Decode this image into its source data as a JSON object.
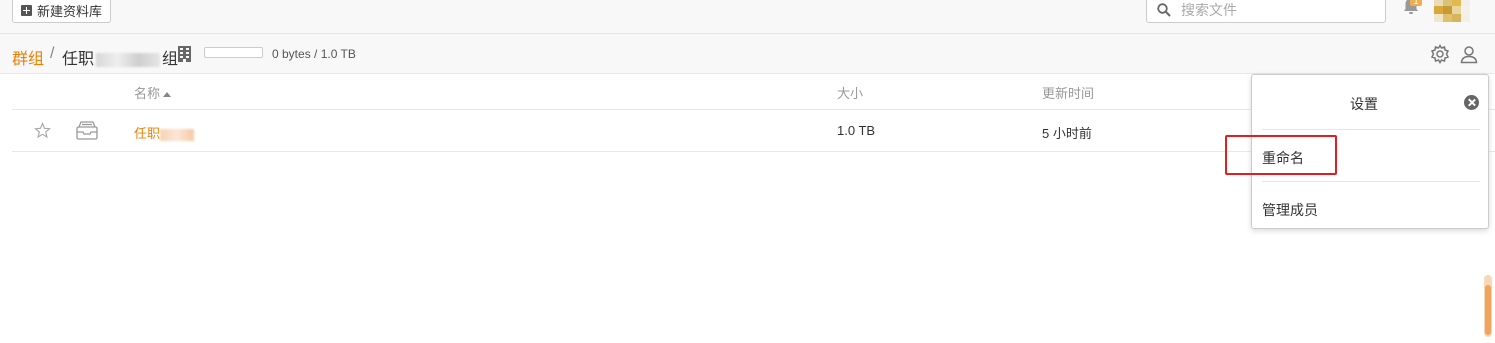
{
  "topbar": {
    "new_library_label": "新建资料库",
    "search_placeholder": "搜索文件",
    "notification_count": "1"
  },
  "pathbar": {
    "crumb_root": "群组",
    "crumb_sep": "/",
    "crumb_current_prefix": "任职",
    "crumb_current_suffix": "组",
    "quota_used_fraction": 0,
    "quota_text": "0 bytes / 1.0 TB"
  },
  "table": {
    "headers": {
      "name": "名称",
      "size": "大小",
      "updated": "更新时间"
    },
    "rows": [
      {
        "name": "任职",
        "size": "1.0 TB",
        "updated": "5 小时前"
      }
    ]
  },
  "dropdown": {
    "title": "设置",
    "items": [
      "重命名",
      "管理成员"
    ]
  },
  "colors": {
    "accent": "#eb8205",
    "highlight_border": "#e02020"
  }
}
